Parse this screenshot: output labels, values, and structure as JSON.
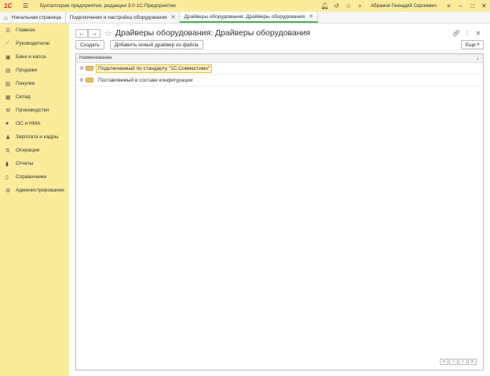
{
  "titlebar": {
    "logo": "1С",
    "app_title": "Бухгалтерия предприятия, редакция 3.0  1С:Предприятие",
    "user_name": "Абрамов Геннадий Сергеевич"
  },
  "tabs": [
    {
      "label": "Начальная страница"
    },
    {
      "label": "Подключение и настройка оборудования"
    },
    {
      "label": "Драйверы оборудования: Драйверы оборудования"
    }
  ],
  "sidebar": {
    "items": [
      {
        "label": "Главное",
        "icon": "menu-icon"
      },
      {
        "label": "Руководителю",
        "icon": "chart-icon"
      },
      {
        "label": "Банк и касса",
        "icon": "bank-icon"
      },
      {
        "label": "Продажи",
        "icon": "sales-icon"
      },
      {
        "label": "Покупки",
        "icon": "cart-icon"
      },
      {
        "label": "Склад",
        "icon": "warehouse-icon"
      },
      {
        "label": "Производство",
        "icon": "factory-icon"
      },
      {
        "label": "ОС и НМА",
        "icon": "assets-icon"
      },
      {
        "label": "Зарплата и кадры",
        "icon": "people-icon"
      },
      {
        "label": "Операции",
        "icon": "operations-icon"
      },
      {
        "label": "Отчеты",
        "icon": "reports-icon"
      },
      {
        "label": "Справочники",
        "icon": "book-icon"
      },
      {
        "label": "Администрирование",
        "icon": "gear-icon"
      }
    ]
  },
  "form": {
    "title": "Драйверы оборудования: Драйверы оборудования",
    "create_label": "Создать",
    "add_driver_label": "Добавить новый драйвер из файла",
    "more_label": "Еще"
  },
  "grid": {
    "column_header": "Наименование",
    "rows": [
      {
        "label": "Подключаемый по стандарту \"1С:Совместимо\"",
        "selected": true
      },
      {
        "label": "Поставляемый в составе конфигурации",
        "selected": false
      }
    ]
  }
}
